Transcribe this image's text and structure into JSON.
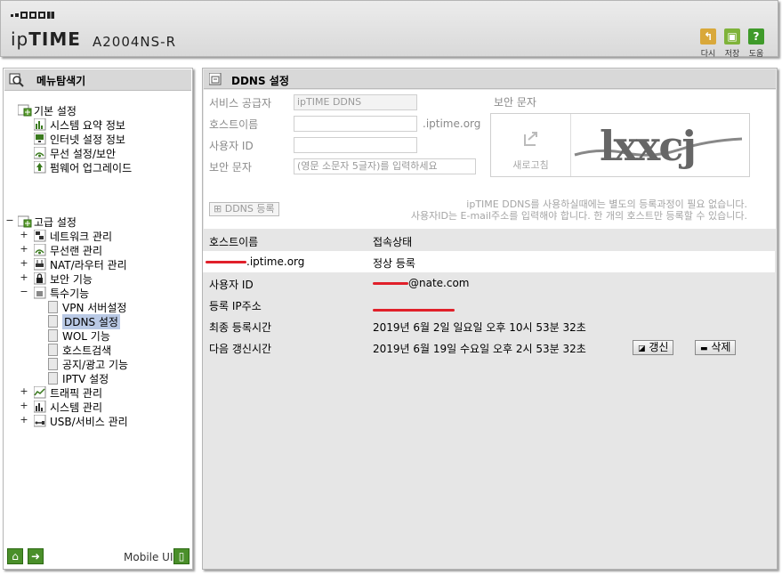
{
  "header": {
    "logo_ip": "ip",
    "logo_time": "TIME",
    "model": "A2004NS-R",
    "buttons": [
      {
        "label": "다시",
        "icon": "undo-icon",
        "color": "#d9a83a"
      },
      {
        "label": "저장",
        "icon": "save-icon",
        "color": "#7fb33a"
      },
      {
        "label": "도움",
        "icon": "help-icon",
        "color": "#3f9a2a"
      }
    ]
  },
  "nav": {
    "title": "메뉴탐색기",
    "basic": {
      "label": "기본 설정",
      "items": [
        "시스템 요약 정보",
        "인터넷 설정 정보",
        "무선 설정/보안",
        "펌웨어 업그레이드"
      ]
    },
    "advanced": {
      "label": "고급 설정",
      "items": [
        "네트워크 관리",
        "무선랜 관리",
        "NAT/라우터 관리",
        "보안 기능",
        "특수기능"
      ],
      "special_items": [
        "VPN 서버설정",
        "DDNS 설정",
        "WOL 기능",
        "호스트검색",
        "공지/광고 기능",
        "IPTV 설정"
      ],
      "more_items": [
        "트래픽 관리",
        "시스템 관리",
        "USB/서비스 관리"
      ]
    },
    "mobile_label": "Mobile UI"
  },
  "main": {
    "title": "DDNS 설정",
    "form": {
      "service_provider_label": "서비스 공급자",
      "service_provider_value": "ipTIME DDNS",
      "hostname_label": "호스트이름",
      "hostname_suffix": ".iptime.org",
      "userid_label": "사용자 ID",
      "captcha_label": "보안 문자",
      "captcha_placeholder": "(영문 소문자 5글자)를 입력하세요",
      "captcha_title": "보안 문자",
      "captcha_refresh_label": "새로고침",
      "captcha_text": "lxxcj",
      "register_button": "DDNS 등록",
      "notice_line1": "ipTIME DDNS를 사용하실때에는 별도의 등록과정이 필요 없습니다.",
      "notice_line2": "사용자ID는 E-mail주소를 입력해야 합니다. 한 개의 호스트만 등록할 수 있습니다."
    },
    "status": {
      "col_hostname": "호스트이름",
      "col_status": "접속상태",
      "host_suffix": ".iptime.org",
      "host_status": "정상 등록",
      "userid_label": "사용자 ID",
      "userid_suffix": "@nate.com",
      "ip_label": "등록 IP주소",
      "last_reg_label": "최종 등록시간",
      "last_reg_value": "2019년 6월 2일 일요일 오후 10시 53분 32초",
      "next_update_label": "다음 갱신시간",
      "next_update_value": "2019년 6월 19일 수요일 오후 2시 53분 32초",
      "refresh_button": "갱신",
      "delete_button": "삭제"
    }
  }
}
